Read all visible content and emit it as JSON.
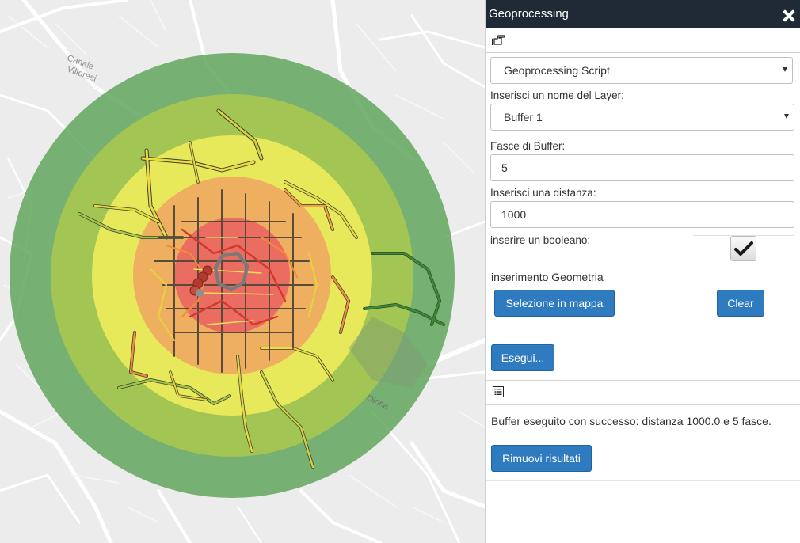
{
  "window": {
    "title": "Geoprocessing"
  },
  "map": {
    "labels": [
      {
        "id": "canale",
        "text": "Canale"
      },
      {
        "id": "villoresi",
        "text": "Villoresi"
      },
      {
        "id": "olona",
        "text": "Olona"
      }
    ],
    "buffer_colors": [
      "#63a65e",
      "#a9c94e",
      "#f0ee5c",
      "#eeaa60",
      "#ea6661"
    ]
  },
  "form": {
    "script_select": {
      "value": "Geoprocessing Script"
    },
    "layer_label": "Inserisci un nome del Layer:",
    "layer_select": {
      "value": "Buffer 1"
    },
    "bands_label": "Fasce di Buffer:",
    "bands_value": "5",
    "distance_label": "Inserisci una distanza:",
    "distance_value": "1000",
    "boolean_label": "inserire un booleano:",
    "boolean_checked": true,
    "geometry_label": "inserimento Geometria",
    "select_map_button": "Selezione in mappa",
    "clear_button": "Clear",
    "run_button": "Esegui..."
  },
  "results": {
    "message": "Buffer eseguito con successo: distanza 1000.0 e 5 fasce.",
    "remove_button": "Rimuovi risultati"
  },
  "icons": {
    "tool": "pointing-hand-icon",
    "results": "list-icon",
    "close": "close-icon"
  }
}
